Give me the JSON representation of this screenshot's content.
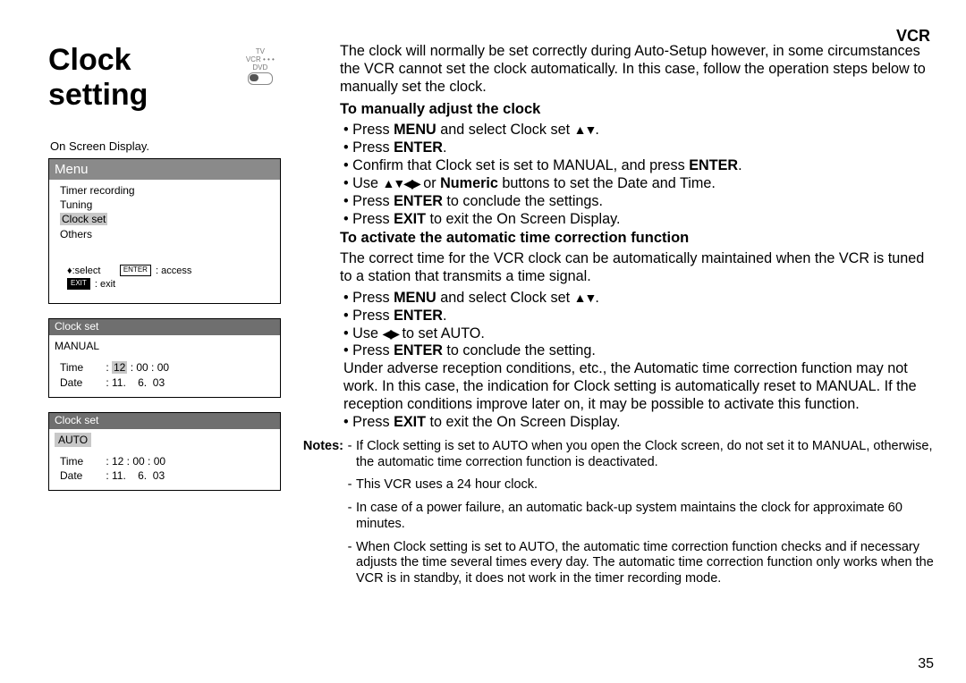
{
  "header": {
    "section": "VCR"
  },
  "title": "Clock setting",
  "toggle_icon": {
    "top": "TV",
    "left": "VCR",
    "dots": "• • •",
    "right": "DVD"
  },
  "left": {
    "caption": "On Screen Display.",
    "menu": {
      "title": "Menu",
      "items": [
        "Timer recording",
        "Tuning",
        "Clock set",
        "Others"
      ],
      "highlight_index": 2,
      "legend_select": "♦:select",
      "legend_access_btn": "ENTER",
      "legend_access_txt": ": access",
      "legend_exit_btn": "EXIT",
      "legend_exit_txt": ": exit"
    },
    "clock1": {
      "title": "Clock set",
      "mode": "MANUAL",
      "time_label": "Time",
      "time_hl": "12",
      "time_rest": " : 00 : 00",
      "date_label": "Date",
      "date_value": "11.    6.  03"
    },
    "clock2": {
      "title": "Clock set",
      "mode": "AUTO",
      "time_label": "Time",
      "time_value": "12 : 00 : 00",
      "date_label": "Date",
      "date_value": "11.    6.  03"
    }
  },
  "right": {
    "intro": "The clock will normally be set correctly during Auto-Setup however, in some circumstances the VCR cannot set the clock automatically. In this case, follow the operation steps below to manually set the clock.",
    "sec1_title": "To manually adjust the clock",
    "sec1_b1a": "Press ",
    "sec1_b1b": "MENU",
    "sec1_b1c": " and select Clock set ",
    "sec1_b2a": "Press ",
    "sec1_b2b": "ENTER",
    "sec1_b2c": ".",
    "sec1_b3a": "Confirm that Clock set is set to MANUAL, and press ",
    "sec1_b3b": "ENTER",
    "sec1_b3c": ".",
    "sec1_b4a": "Use ",
    "sec1_b4b": " or ",
    "sec1_b4c": "Numeric",
    "sec1_b4d": " buttons to set the Date and Time.",
    "sec1_b5a": "Press ",
    "sec1_b5b": "ENTER",
    "sec1_b5c": " to conclude the settings.",
    "sec1_b6a": "Press ",
    "sec1_b6b": "EXIT",
    "sec1_b6c": " to exit the On Screen Display.",
    "sec2_title": "To activate the automatic time correction function",
    "sec2_intro": "The correct time for the VCR clock can be automatically maintained when the VCR is tuned to a station that transmits a time signal.",
    "sec2_b1a": "Press ",
    "sec2_b1b": "MENU",
    "sec2_b1c": " and select Clock set ",
    "sec2_b2a": "Press ",
    "sec2_b2b": "ENTER",
    "sec2_b2c": ".",
    "sec2_b3a": "Use  ",
    "sec2_b3b": " to set AUTO.",
    "sec2_b4a": "Press ",
    "sec2_b4b": "ENTER",
    "sec2_b4c": " to conclude the setting.",
    "sec2_note": "Under adverse reception conditions, etc., the Automatic time correction function may not work. In this case, the indication for Clock setting is automatically reset to MANUAL. If the reception conditions improve later on, it may be possible to activate this function.",
    "sec2_b5a": "Press ",
    "sec2_b5b": "EXIT",
    "sec2_b5c": " to exit the On Screen Display.",
    "notes_label": "Notes:",
    "notes": [
      "If Clock setting is set to AUTO when you open the Clock screen, do not set it to MANUAL, otherwise, the automatic time correction function is deactivated.",
      "This VCR uses a 24 hour clock.",
      "In case of a power failure, an automatic back-up system maintains the clock for approximate 60 minutes.",
      "When Clock setting is set to AUTO, the automatic time correction function checks and if necessary adjusts the time several times every day. The automatic time correction function only works when the VCR is in standby, it does not work in the timer recording mode."
    ]
  },
  "page_number": "35"
}
